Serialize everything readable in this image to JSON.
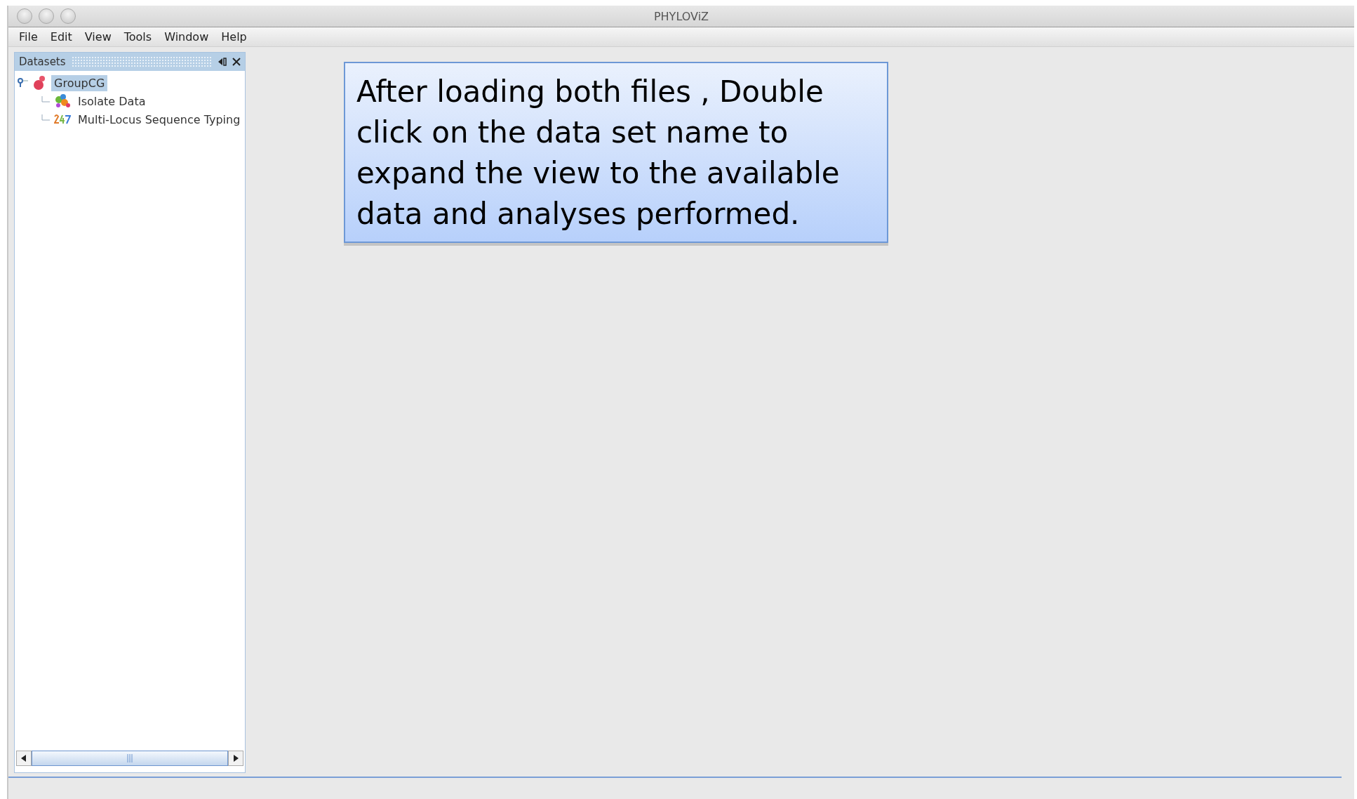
{
  "window": {
    "title": "PHYLOViZ"
  },
  "menu": [
    "File",
    "Edit",
    "View",
    "Tools",
    "Window",
    "Help"
  ],
  "panel": {
    "title": "Datasets",
    "tree": [
      {
        "label": "GroupCG",
        "kind": "dataset",
        "selected": true,
        "expanded": true,
        "children": [
          {
            "label": "Isolate Data",
            "kind": "isolates",
            "selected": false
          },
          {
            "label": "Multi-Locus Sequence Typing",
            "kind": "mlst",
            "selected": false
          }
        ]
      }
    ]
  },
  "callout": {
    "text": "After loading both files , Double click on the data set name to expand the view to the available data and analyses performed."
  }
}
